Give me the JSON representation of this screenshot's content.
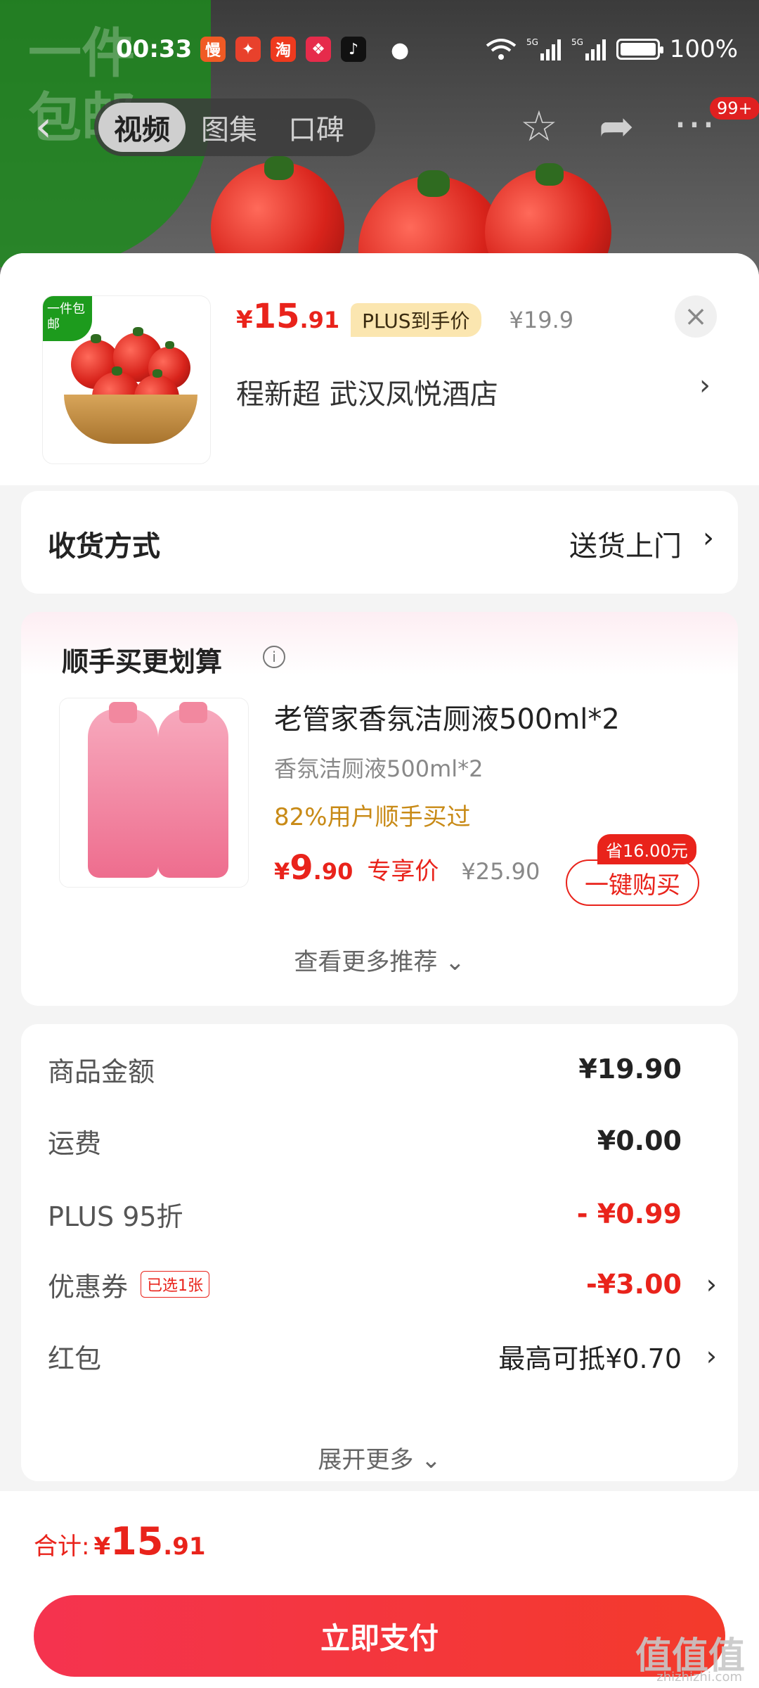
{
  "status_bar": {
    "time": "00:33",
    "battery": "100%",
    "network": "5G"
  },
  "background": {
    "promo_text_line1": "一件",
    "promo_text_line2": "包邮"
  },
  "header": {
    "tabs": [
      {
        "label": "视频",
        "active": true
      },
      {
        "label": "图集",
        "active": false
      },
      {
        "label": "口碑",
        "active": false
      }
    ],
    "badge": "99+"
  },
  "product": {
    "tag": "一件包邮",
    "price_symbol": "¥",
    "price_int": "15",
    "price_dec": ".91",
    "plus_label": "PLUS到手价",
    "original_price": "¥19.9",
    "address": "程新超  武汉凤悦酒店"
  },
  "delivery": {
    "label": "收货方式",
    "value": "送货上门"
  },
  "recommend": {
    "title": "顺手买更划算",
    "name": "老管家香氛洁厕液500ml*2",
    "spec": "香氛洁厕液500ml*2",
    "stat": "82%用户顺手买过",
    "price_symbol": "¥",
    "price_int": "9",
    "price_dec": ".90",
    "exclusive_label": "专享价",
    "original_price": "¥25.90",
    "save_tag": "省16.00元",
    "buy_label": "一键购买",
    "more_label": "查看更多推荐"
  },
  "summary": {
    "rows": [
      {
        "key": "商品金额",
        "value": "¥19.90"
      },
      {
        "key": "运费",
        "value": "¥0.00"
      },
      {
        "key": "PLUS 95折",
        "value": "- ¥0.99"
      },
      {
        "key": "优惠券",
        "value": "-¥3.00",
        "badge": "已选1张"
      },
      {
        "key": "红包",
        "value": "最高可抵¥0.70"
      }
    ],
    "expand_label": "展开更多"
  },
  "footer": {
    "total_label": "合计:",
    "total_symbol": "¥",
    "total_int": "15",
    "total_dec": ".91",
    "pay_label": "立即支付"
  },
  "watermark": {
    "text": "值值值",
    "sub": "zhizhizhi.com"
  },
  "colors": {
    "accent": "#e9231b",
    "plus_tag_bg": "#fbe6b0",
    "stat_color": "#c88a16"
  }
}
